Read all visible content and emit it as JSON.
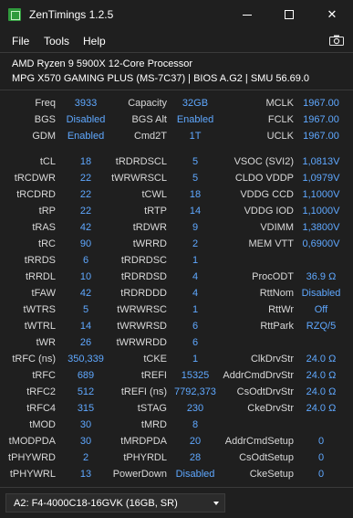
{
  "window": {
    "title": "ZenTimings 1.2.5",
    "minimize_icon": "minimize-icon",
    "maximize_icon": "maximize-icon",
    "close_glyph": "✕"
  },
  "menu": {
    "file": "File",
    "tools": "Tools",
    "help": "Help",
    "screenshot_icon": "camera-icon"
  },
  "system": {
    "cpu": "AMD Ryzen 9 5900X 12-Core Processor",
    "board": "MPG X570 GAMING PLUS (MS-7C37) | BIOS A.G2 | SMU 56.69.0"
  },
  "rows": [
    {
      "l1": "Freq",
      "v1": "3933",
      "l2": "Capacity",
      "v2": "32GB",
      "l3": "MCLK",
      "v3": "1967.00"
    },
    {
      "l1": "BGS",
      "v1": "Disabled",
      "l2": "BGS Alt",
      "v2": "Enabled",
      "l3": "FCLK",
      "v3": "1967.00"
    },
    {
      "l1": "GDM",
      "v1": "Enabled",
      "l2": "Cmd2T",
      "v2": "1T",
      "l3": "UCLK",
      "v3": "1967.00"
    },
    {
      "l1": "tCL",
      "v1": "18",
      "l2": "tRDRDSCL",
      "v2": "5",
      "l3": "VSOC (SVI2)",
      "v3": "1,0813V"
    },
    {
      "l1": "tRCDWR",
      "v1": "22",
      "l2": "tWRWRSCL",
      "v2": "5",
      "l3": "CLDO VDDP",
      "v3": "1,0979V"
    },
    {
      "l1": "tRCDRD",
      "v1": "22",
      "l2": "tCWL",
      "v2": "18",
      "l3": "VDDG CCD",
      "v3": "1,1000V"
    },
    {
      "l1": "tRP",
      "v1": "22",
      "l2": "tRTP",
      "v2": "14",
      "l3": "VDDG IOD",
      "v3": "1,1000V"
    },
    {
      "l1": "tRAS",
      "v1": "42",
      "l2": "tRDWR",
      "v2": "9",
      "l3": "VDIMM",
      "v3": "1,3800V"
    },
    {
      "l1": "tRC",
      "v1": "90",
      "l2": "tWRRD",
      "v2": "2",
      "l3": "MEM VTT",
      "v3": "0,6900V"
    },
    {
      "l1": "tRRDS",
      "v1": "6",
      "l2": "tRDRDSC",
      "v2": "1",
      "l3": "",
      "v3": ""
    },
    {
      "l1": "tRRDL",
      "v1": "10",
      "l2": "tRDRDSD",
      "v2": "4",
      "l3": "ProcODT",
      "v3": "36.9 Ω"
    },
    {
      "l1": "tFAW",
      "v1": "42",
      "l2": "tRDRDDD",
      "v2": "4",
      "l3": "RttNom",
      "v3": "Disabled"
    },
    {
      "l1": "tWTRS",
      "v1": "5",
      "l2": "tWRWRSC",
      "v2": "1",
      "l3": "RttWr",
      "v3": "Off"
    },
    {
      "l1": "tWTRL",
      "v1": "14",
      "l2": "tWRWRSD",
      "v2": "6",
      "l3": "RttPark",
      "v3": "RZQ/5"
    },
    {
      "l1": "tWR",
      "v1": "26",
      "l2": "tWRWRDD",
      "v2": "6",
      "l3": "",
      "v3": ""
    },
    {
      "l1": "tRFC (ns)",
      "v1": "350,339",
      "l2": "tCKE",
      "v2": "1",
      "l3": "ClkDrvStr",
      "v3": "24.0 Ω"
    },
    {
      "l1": "tRFC",
      "v1": "689",
      "l2": "tREFI",
      "v2": "15325",
      "l3": "AddrCmdDrvStr",
      "v3": "24.0 Ω"
    },
    {
      "l1": "tRFC2",
      "v1": "512",
      "l2": "tREFI (ns)",
      "v2": "7792,373",
      "l3": "CsOdtDrvStr",
      "v3": "24.0 Ω"
    },
    {
      "l1": "tRFC4",
      "v1": "315",
      "l2": "tSTAG",
      "v2": "230",
      "l3": "CkeDrvStr",
      "v3": "24.0 Ω"
    },
    {
      "l1": "tMOD",
      "v1": "30",
      "l2": "tMRD",
      "v2": "8",
      "l3": "",
      "v3": ""
    },
    {
      "l1": "tMODPDA",
      "v1": "30",
      "l2": "tMRDPDA",
      "v2": "20",
      "l3": "AddrCmdSetup",
      "v3": "0"
    },
    {
      "l1": "tPHYWRD",
      "v1": "2",
      "l2": "tPHYRDL",
      "v2": "28",
      "l3": "CsOdtSetup",
      "v3": "0"
    },
    {
      "l1": "tPHYWRL",
      "v1": "13",
      "l2": "PowerDown",
      "v2": "Disabled",
      "l3": "CkeSetup",
      "v3": "0"
    }
  ],
  "footer": {
    "module": "A2: F4-4000C18-16GVK (16GB, SR)"
  }
}
